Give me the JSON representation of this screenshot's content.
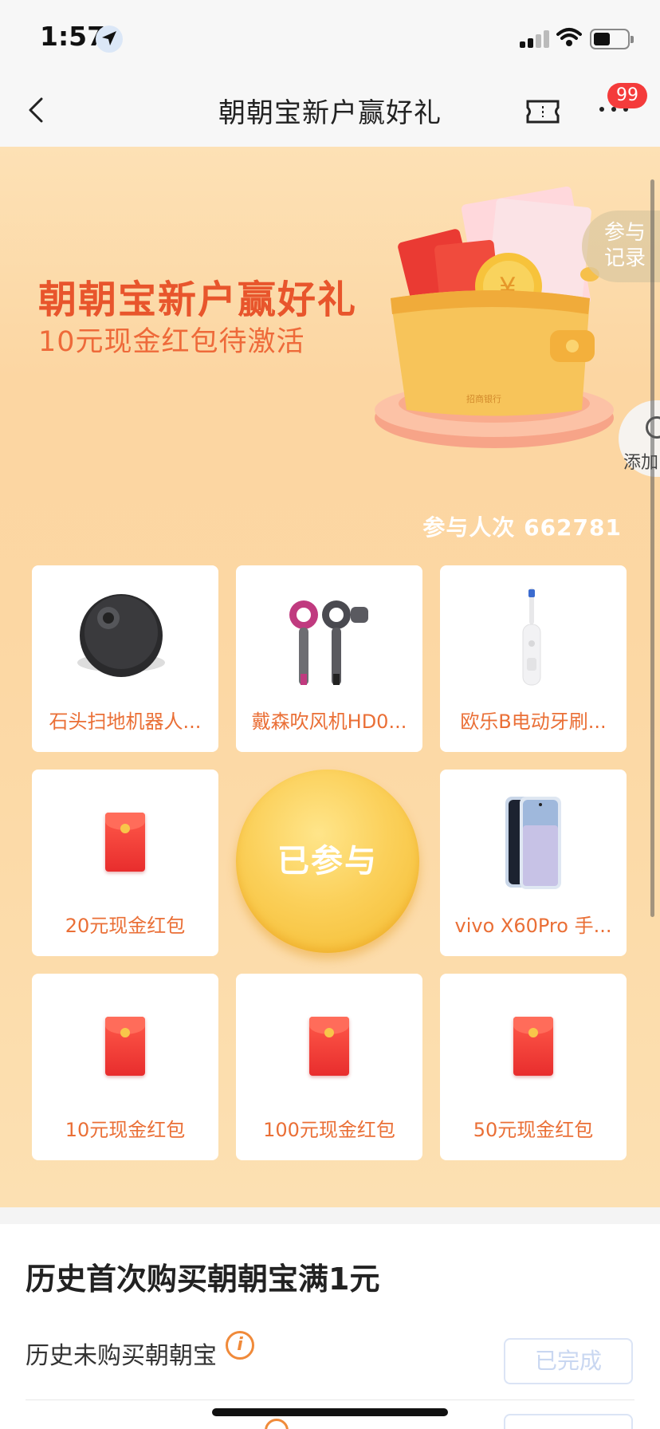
{
  "status_bar": {
    "time": "1:57"
  },
  "nav": {
    "title": "朝朝宝新户赢好礼",
    "badge": "99"
  },
  "banner": {
    "title": "朝朝宝新户赢好礼",
    "subtitle": "10元现金红包待激活",
    "record_tab": "参与\n记录",
    "add_tab": "添加",
    "participants": "参与人次 662781"
  },
  "prizes": [
    {
      "label": "石头扫地机器人...",
      "icon": "robot-vacuum"
    },
    {
      "label": "戴森吹风机HD0...",
      "icon": "hair-dryer"
    },
    {
      "label": "欧乐B电动牙刷...",
      "icon": "toothbrush"
    },
    {
      "label": "20元现金红包",
      "icon": "red-envelope"
    },
    {
      "label": "vivo X60Pro 手...",
      "icon": "phone"
    },
    {
      "label": "10元现金红包",
      "icon": "red-envelope"
    },
    {
      "label": "100元现金红包",
      "icon": "red-envelope"
    },
    {
      "label": "50元现金红包",
      "icon": "red-envelope"
    }
  ],
  "center_button": "已参与",
  "task": {
    "title": "历史首次购买朝朝宝满1元",
    "row_label": "历史未购买朝朝宝",
    "button": "已完成"
  },
  "colors": {
    "accent": "#e8552c",
    "label_orange": "#ea6f36",
    "badge_red": "#f43b3b"
  }
}
